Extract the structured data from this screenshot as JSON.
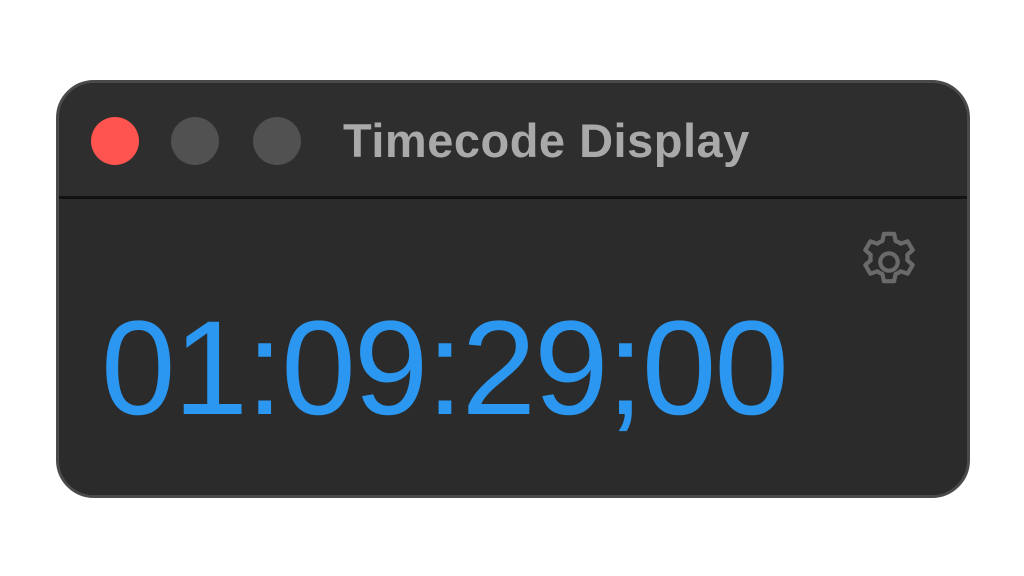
{
  "window": {
    "title": "Timecode Display",
    "title_color": "#a9a9a9",
    "controls": {
      "close_color": "#ff5450",
      "minimize_color": "#515151",
      "zoom_color": "#515151"
    }
  },
  "settings": {
    "icon": "gear-icon",
    "icon_color": "#6a6a6a"
  },
  "timecode": {
    "value": "01:09:29;00",
    "color": "#2b97f0"
  },
  "colors": {
    "window_background": "#2b2b2b",
    "page_background": "#ffffff"
  }
}
